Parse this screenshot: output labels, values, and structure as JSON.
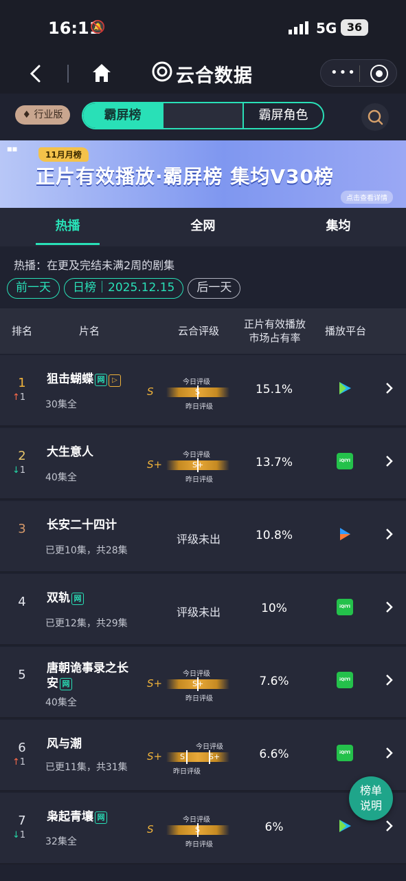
{
  "status": {
    "time": "16:11",
    "network": "5G",
    "battery": "36"
  },
  "nav": {
    "title": "云合数据"
  },
  "filter": {
    "version_badge": "行业版",
    "segments": [
      "霸屏榜",
      "",
      "霸屏角色"
    ]
  },
  "banner": {
    "tag": "11月月榜",
    "title": "正片有效播放·霸屏榜 集均V30榜",
    "button": "点击查看详情"
  },
  "tabs": [
    "热播",
    "全网",
    "集均"
  ],
  "description": "热播：在更及完结未满2周的剧集",
  "dates": {
    "prev": "前一天",
    "current": "日榜｜2025.12.15",
    "next": "后一天"
  },
  "table": {
    "headers": {
      "rank": "排名",
      "title": "片名",
      "grade": "云合评级",
      "share_line1": "正片有效播放",
      "share_line2": "市场占有率",
      "platform": "播放平台"
    },
    "grade_labels": {
      "today": "今日评级",
      "yesterday": "昨日评级"
    },
    "rows": [
      {
        "rank": "1",
        "trend": "1",
        "name": "狙击蝴蝶",
        "sub": "30集全",
        "grade": "S",
        "mark": "S",
        "grade_text": "",
        "share": "15.1%",
        "platform": "tencent"
      },
      {
        "rank": "2",
        "trend": "1",
        "name": "大生意人",
        "sub": "40集全",
        "grade": "S+",
        "mark": "S+",
        "grade_text": "",
        "share": "13.7%",
        "platform": "iqiyi"
      },
      {
        "rank": "3",
        "trend": "",
        "name": "长安二十四计",
        "sub": "已更10集，共28集",
        "grade": "",
        "mark": "",
        "grade_text": "评级未出",
        "share": "10.8%",
        "platform": "youku"
      },
      {
        "rank": "4",
        "trend": "",
        "name": "双轨",
        "sub": "已更12集，共29集",
        "grade": "",
        "mark": "",
        "grade_text": "评级未出",
        "share": "10%",
        "platform": "iqiyi"
      },
      {
        "rank": "5",
        "trend": "",
        "name_line1": "唐朝诡事录之长",
        "name_line2": "安",
        "sub": "40集全",
        "grade": "S+",
        "mark": "S+",
        "grade_text": "",
        "share": "7.6%",
        "platform": "iqiyi"
      },
      {
        "rank": "6",
        "trend": "1",
        "name": "风与潮",
        "sub": "已更11集，共31集",
        "grade": "S+",
        "mark_left": "S",
        "mark_right": "S+",
        "grade_text": "",
        "share": "6.6%",
        "platform": "iqiyi"
      },
      {
        "rank": "7",
        "trend": "1",
        "name": "枭起青壤",
        "sub": "32集全",
        "grade": "S",
        "mark": "S",
        "grade_text": "",
        "share": "6%",
        "platform": "tencent"
      }
    ],
    "tags": {
      "web": "网",
      "play": "▷"
    },
    "iqiyi_logo": "iQIYI"
  },
  "float_button": {
    "line1": "榜单",
    "line2": "说明"
  },
  "colors": {
    "accent": "#29e0b7",
    "gold": "#f0b33b",
    "up": "#ff6b4a",
    "down": "#25d6a6"
  }
}
